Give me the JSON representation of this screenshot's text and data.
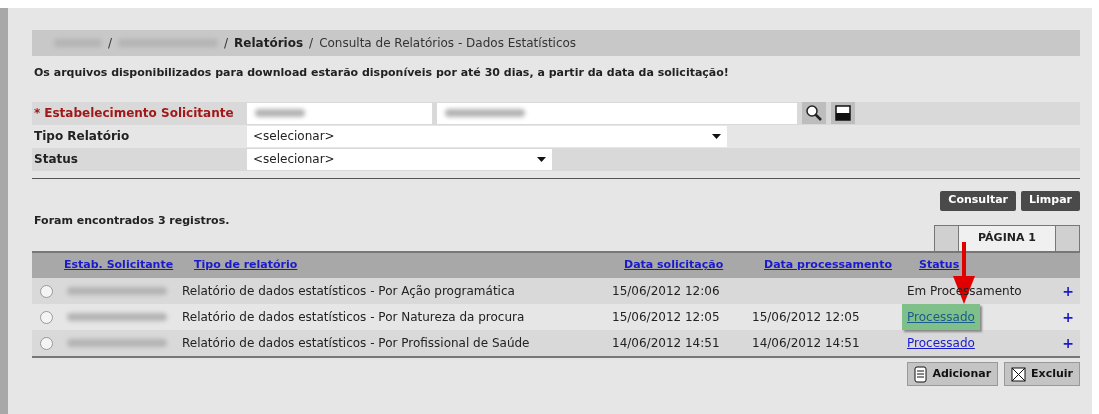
{
  "breadcrumb": {
    "current_section": "Relatórios",
    "separator": "/",
    "page": "Consulta de Relatórios - Dados Estatísticos"
  },
  "notice": "Os arquivos disponibilizados para download estarão disponíveis por até 30 dias, a partir da data da solicitação!",
  "form": {
    "fields": [
      {
        "label": "Estabelecimento Solicitante",
        "required_mark": "*",
        "kind": "lookup"
      },
      {
        "label": "Tipo Relatório",
        "kind": "select",
        "value": "<selecionar>"
      },
      {
        "label": "Status",
        "kind": "select",
        "value": "<selecionar>"
      }
    ]
  },
  "actions": [
    "Consultar",
    "Limpar"
  ],
  "result_count": "Foram encontrados 3 registros.",
  "pagination": {
    "label": "PÁGINA 1"
  },
  "table": {
    "columns": [
      "Estab. Solicitante",
      "Tipo de relatório",
      "Data solicitação",
      "Data processamento",
      "Status"
    ],
    "rows": [
      {
        "selected": false,
        "tipo": "Relatório de dados estatísticos - Por Ação programática",
        "data_solicitacao": "15/06/2012 12:06",
        "data_processamento": "",
        "status": "Em Processamento",
        "status_link": false,
        "highlighted": false,
        "expand": "+"
      },
      {
        "selected": false,
        "tipo": "Relatório de dados estatísticos - Por Natureza da procura",
        "data_solicitacao": "15/06/2012 12:05",
        "data_processamento": "15/06/2012 12:05",
        "status": "Processado",
        "status_link": true,
        "highlighted": true,
        "expand": "+"
      },
      {
        "selected": false,
        "tipo": "Relatório de dados estatísticos - Por Profissional de Saúde",
        "data_solicitacao": "14/06/2012 14:51",
        "data_processamento": "14/06/2012 14:51",
        "status": "Processado",
        "status_link": true,
        "highlighted": false,
        "expand": "+"
      }
    ]
  },
  "bottom_actions": [
    {
      "label": "Adicionar",
      "kind": "add"
    },
    {
      "label": "Excluir",
      "kind": "delete"
    }
  ]
}
